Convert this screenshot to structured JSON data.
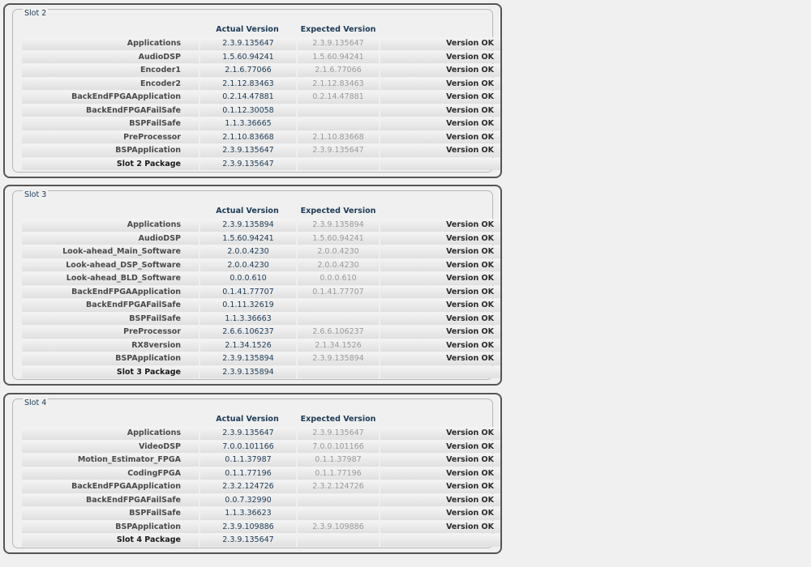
{
  "headers": {
    "actual": "Actual Version",
    "expected": "Expected Version"
  },
  "slots": [
    {
      "legend": "Slot 2",
      "rows": [
        {
          "name": "Applications",
          "actual": "2.3.9.135647",
          "expected": "2.3.9.135647",
          "status": "Version OK"
        },
        {
          "name": "AudioDSP",
          "actual": "1.5.60.94241",
          "expected": "1.5.60.94241",
          "status": "Version OK"
        },
        {
          "name": "Encoder1",
          "actual": "2.1.6.77066",
          "expected": "2.1.6.77066",
          "status": "Version OK"
        },
        {
          "name": "Encoder2",
          "actual": "2.1.12.83463",
          "expected": "2.1.12.83463",
          "status": "Version OK"
        },
        {
          "name": "BackEndFPGAApplication",
          "actual": "0.2.14.47881",
          "expected": "0.2.14.47881",
          "status": "Version OK"
        },
        {
          "name": "BackEndFPGAFailSafe",
          "actual": "0.1.12.30058",
          "expected": "",
          "status": "Version OK"
        },
        {
          "name": "BSPFailSafe",
          "actual": "1.1.3.36665",
          "expected": "",
          "status": "Version OK"
        },
        {
          "name": "PreProcessor",
          "actual": "2.1.10.83668",
          "expected": "2.1.10.83668",
          "status": "Version OK"
        },
        {
          "name": "BSPApplication",
          "actual": "2.3.9.135647",
          "expected": "2.3.9.135647",
          "status": "Version OK"
        },
        {
          "name": "Slot 2 Package",
          "actual": "2.3.9.135647",
          "expected": "",
          "status": "",
          "package": true
        }
      ]
    },
    {
      "legend": "Slot 3",
      "rows": [
        {
          "name": "Applications",
          "actual": "2.3.9.135894",
          "expected": "2.3.9.135894",
          "status": "Version OK"
        },
        {
          "name": "AudioDSP",
          "actual": "1.5.60.94241",
          "expected": "1.5.60.94241",
          "status": "Version OK"
        },
        {
          "name": "Look-ahead_Main_Software",
          "actual": "2.0.0.4230",
          "expected": "2.0.0.4230",
          "status": "Version OK"
        },
        {
          "name": "Look-ahead_DSP_Software",
          "actual": "2.0.0.4230",
          "expected": "2.0.0.4230",
          "status": "Version OK"
        },
        {
          "name": "Look-ahead_BLD_Software",
          "actual": "0.0.0.610",
          "expected": "0.0.0.610",
          "status": "Version OK"
        },
        {
          "name": "BackEndFPGAApplication",
          "actual": "0.1.41.77707",
          "expected": "0.1.41.77707",
          "status": "Version OK"
        },
        {
          "name": "BackEndFPGAFailSafe",
          "actual": "0.1.11.32619",
          "expected": "",
          "status": "Version OK"
        },
        {
          "name": "BSPFailSafe",
          "actual": "1.1.3.36663",
          "expected": "",
          "status": "Version OK"
        },
        {
          "name": "PreProcessor",
          "actual": "2.6.6.106237",
          "expected": "2.6.6.106237",
          "status": "Version OK"
        },
        {
          "name": "RX8version",
          "actual": "2.1.34.1526",
          "expected": "2.1.34.1526",
          "status": "Version OK"
        },
        {
          "name": "BSPApplication",
          "actual": "2.3.9.135894",
          "expected": "2.3.9.135894",
          "status": "Version OK"
        },
        {
          "name": "Slot 3 Package",
          "actual": "2.3.9.135894",
          "expected": "",
          "status": "",
          "package": true
        }
      ]
    },
    {
      "legend": "Slot 4",
      "rows": [
        {
          "name": "Applications",
          "actual": "2.3.9.135647",
          "expected": "2.3.9.135647",
          "status": "Version OK"
        },
        {
          "name": "VideoDSP",
          "actual": "7.0.0.101166",
          "expected": "7.0.0.101166",
          "status": "Version OK"
        },
        {
          "name": "Motion_Estimator_FPGA",
          "actual": "0.1.1.37987",
          "expected": "0.1.1.37987",
          "status": "Version OK"
        },
        {
          "name": "CodingFPGA",
          "actual": "0.1.1.77196",
          "expected": "0.1.1.77196",
          "status": "Version OK"
        },
        {
          "name": "BackEndFPGAApplication",
          "actual": "2.3.2.124726",
          "expected": "2.3.2.124726",
          "status": "Version OK"
        },
        {
          "name": "BackEndFPGAFailSafe",
          "actual": "0.0.7.32990",
          "expected": "",
          "status": "Version OK"
        },
        {
          "name": "BSPFailSafe",
          "actual": "1.1.3.36623",
          "expected": "",
          "status": "Version OK"
        },
        {
          "name": "BSPApplication",
          "actual": "2.3.9.109886",
          "expected": "2.3.9.109886",
          "status": "Version OK"
        },
        {
          "name": "Slot 4 Package",
          "actual": "2.3.9.135647",
          "expected": "",
          "status": "",
          "package": true
        }
      ]
    }
  ]
}
